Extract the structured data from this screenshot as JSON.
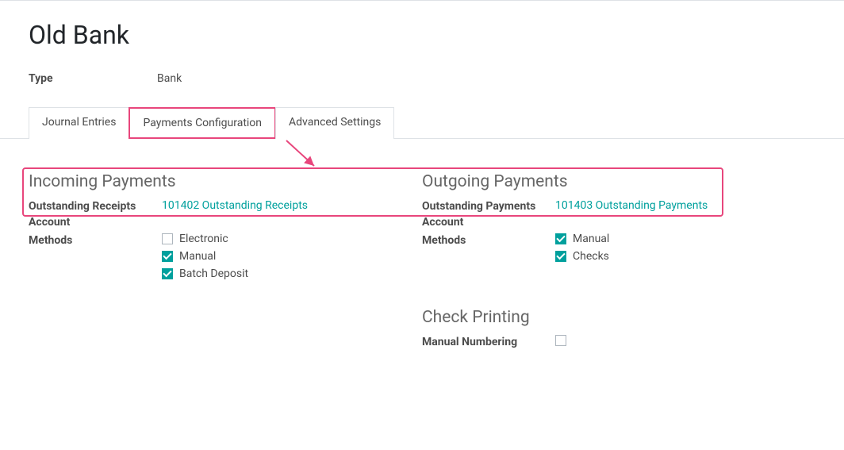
{
  "title": "Old Bank",
  "type_label": "Type",
  "type_value": "Bank",
  "tabs": {
    "journal_entries": "Journal Entries",
    "payments_config": "Payments Configuration",
    "advanced_settings": "Advanced Settings"
  },
  "incoming": {
    "section_title": "Incoming Payments",
    "outstanding_label": "Outstanding Receipts Account",
    "outstanding_value": "101402 Outstanding Receipts",
    "methods_label": "Methods",
    "methods": {
      "electronic": "Electronic",
      "manual": "Manual",
      "batch_deposit": "Batch Deposit"
    }
  },
  "outgoing": {
    "section_title": "Outgoing Payments",
    "outstanding_label": "Outstanding Payments Account",
    "outstanding_value": "101403 Outstanding Payments",
    "methods_label": "Methods",
    "methods": {
      "manual": "Manual",
      "checks": "Checks"
    }
  },
  "check_printing": {
    "section_title": "Check Printing",
    "manual_numbering_label": "Manual Numbering"
  }
}
